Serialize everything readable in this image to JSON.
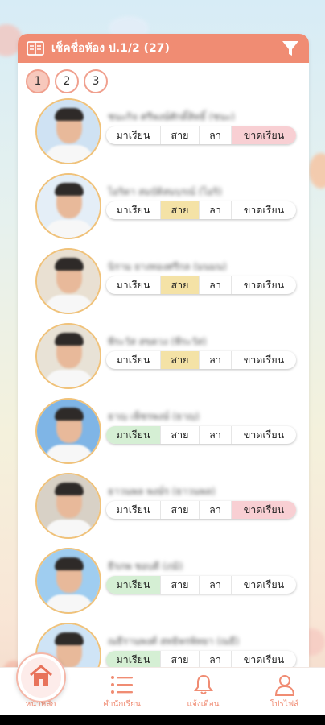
{
  "header": {
    "title": "เช็คชื่อห้อง ป.1/2 (27)",
    "book_icon": "book-icon",
    "filter_icon": "filter-icon"
  },
  "pager": {
    "pages": [
      "1",
      "2",
      "3"
    ],
    "active": "1"
  },
  "status_labels": {
    "present": "มาเรียน",
    "late": "สาย",
    "leave": "ลา",
    "absent": "ขาดเรียน"
  },
  "students": [
    {
      "name": "ชนะกิจ ศรีพงษ์ศักดิ์สิทธิ์ (ชนะ)",
      "status": "absent",
      "photo_bg": "#cfe2f3"
    },
    {
      "name": "ไอริดา สมบัติสมบูรณ์ (ไอริ)",
      "status": "late",
      "photo_bg": "#e4eef7"
    },
    {
      "name": "นิรามุ ยางทองศรีกุล (มนมน)",
      "status": "late",
      "photo_bg": "#e9e0d2"
    },
    {
      "name": "พีระวัส สุขดวง (พีระวัส)",
      "status": "late",
      "photo_bg": "#e8e2d6"
    },
    {
      "name": "ธาญ เพ็ชรพงษ์ (ธาญ)",
      "status": "present",
      "photo_bg": "#7fb5e6"
    },
    {
      "name": "ธาวนพล พงษ์ร (ธาวนพล)",
      "status": "absent",
      "photo_bg": "#d8d1c6"
    },
    {
      "name": "ธีรภพ ชอบดี (ภูมิ)",
      "status": "present",
      "photo_bg": "#9fcdf0"
    },
    {
      "name": "ณธีรานุพงศ์ สุทธิพรพิทยา (ณธี)",
      "status": "present",
      "photo_bg": "#cfe4f6"
    }
  ],
  "tabs": [
    {
      "label": "หน้าหลัก",
      "icon": "home-icon"
    },
    {
      "label": "คำนักเรียน",
      "icon": "list-icon"
    },
    {
      "label": "แจ้งเตือน",
      "icon": "bell-icon"
    },
    {
      "label": "โปรไฟล์",
      "icon": "user-icon"
    }
  ],
  "colors": {
    "accent": "#f08c73",
    "present": "#d5efd4",
    "late": "#f4e2a6",
    "absent": "#f8cfd3"
  }
}
